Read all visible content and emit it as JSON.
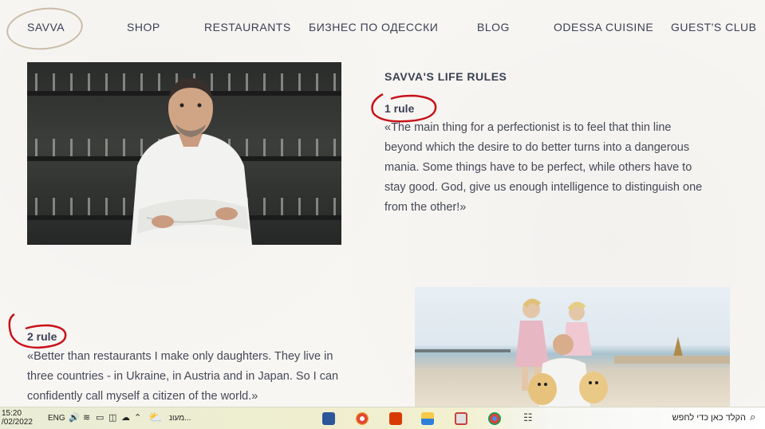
{
  "nav": {
    "items": [
      "SAVVA",
      "SHOP",
      "RESTAURANTS",
      "БИЗНЕС ПО ОДЕССКИ",
      "BLOG",
      "ODESSA CUISINE",
      "GUEST'S CLUB"
    ]
  },
  "section": {
    "heading": "SAVVA'S LIFE RULES",
    "rule1": {
      "label": "1 rule",
      "lines": [
        "«The main thing for a perfectionist is to feel that thin line",
        "beyond which the desire to do better turns into a dangerous",
        "mania. Some things have to be perfect, while others have to",
        "stay good. God, give us enough intelligence to distinguish one",
        "from the other!»"
      ]
    },
    "rule2": {
      "label": "2 rule",
      "lines": [
        "«Better than restaurants I make only daughters. They live in",
        "three countries - in Ukraine, in Austria and in Japan. So I can",
        "confidently call myself a citizen of the world.»"
      ]
    }
  },
  "taskbar": {
    "time": "15:20",
    "date": "/02/2022",
    "lang": "ENG",
    "weather_text": "מעונ...",
    "search_placeholder": "הקלד כאן כדי לחפש"
  },
  "colors": {
    "annotation_red": "#c8121a",
    "nav_text": "#3b4054"
  }
}
